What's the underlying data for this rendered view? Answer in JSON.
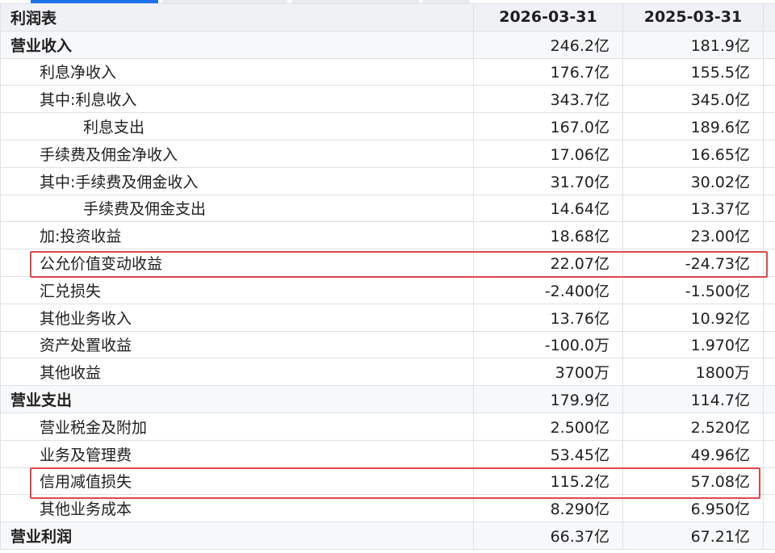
{
  "table": {
    "title": "利润表",
    "periods": [
      "2026-03-31",
      "2025-03-31"
    ],
    "rows": [
      {
        "label": "营业收入",
        "level": 0,
        "values": [
          "246.2亿",
          "181.9亿"
        ]
      },
      {
        "label": "利息净收入",
        "level": 1,
        "values": [
          "176.7亿",
          "155.5亿"
        ]
      },
      {
        "label": "其中:利息收入",
        "level": 1,
        "values": [
          "343.7亿",
          "345.0亿"
        ]
      },
      {
        "label": "利息支出",
        "level": 2,
        "values": [
          "167.0亿",
          "189.6亿"
        ]
      },
      {
        "label": "手续费及佣金净收入",
        "level": 1,
        "values": [
          "17.06亿",
          "16.65亿"
        ]
      },
      {
        "label": "其中:手续费及佣金收入",
        "level": 1,
        "values": [
          "31.70亿",
          "30.02亿"
        ]
      },
      {
        "label": "手续费及佣金支出",
        "level": 2,
        "values": [
          "14.64亿",
          "13.37亿"
        ]
      },
      {
        "label": "加:投资收益",
        "level": 1,
        "values": [
          "18.68亿",
          "23.00亿"
        ]
      },
      {
        "label": "公允价值变动收益",
        "level": 1,
        "values": [
          "22.07亿",
          "-24.73亿"
        ],
        "highlighted": true
      },
      {
        "label": "汇兑损失",
        "level": 1,
        "values": [
          "-2.400亿",
          "-1.500亿"
        ]
      },
      {
        "label": "其他业务收入",
        "level": 1,
        "values": [
          "13.76亿",
          "10.92亿"
        ]
      },
      {
        "label": "资产处置收益",
        "level": 1,
        "values": [
          "-100.0万",
          "1.970亿"
        ]
      },
      {
        "label": "其他收益",
        "level": 1,
        "values": [
          "3700万",
          "1800万"
        ]
      },
      {
        "label": "营业支出",
        "level": 0,
        "values": [
          "179.9亿",
          "114.7亿"
        ]
      },
      {
        "label": "营业税金及附加",
        "level": 1,
        "values": [
          "2.500亿",
          "2.520亿"
        ]
      },
      {
        "label": "业务及管理费",
        "level": 1,
        "values": [
          "53.45亿",
          "49.96亿"
        ]
      },
      {
        "label": "信用减值损失",
        "level": 1,
        "values": [
          "115.2亿",
          "57.08亿"
        ],
        "highlighted": true
      },
      {
        "label": "其他业务成本",
        "level": 1,
        "values": [
          "8.290亿",
          "6.950亿"
        ]
      },
      {
        "label": "营业利润",
        "level": 0,
        "values": [
          "66.37亿",
          "67.21亿"
        ]
      }
    ]
  },
  "colors": {
    "tab_active": "#1a73e8",
    "highlight_box": "#e0474b",
    "header_bg": "#f0f1f4",
    "grid": "#dfe1e6"
  }
}
